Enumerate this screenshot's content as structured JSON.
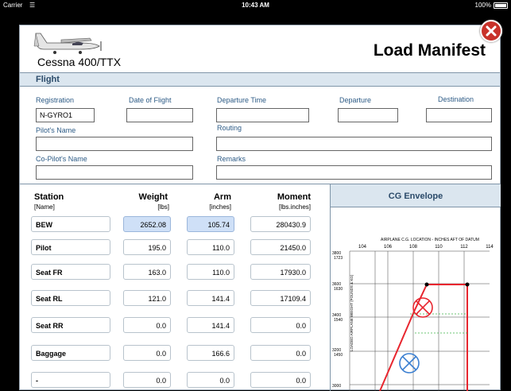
{
  "status_bar": {
    "carrier": "Carrier",
    "time": "10:43 AM",
    "battery": "100%"
  },
  "header": {
    "model": "Cessna 400/TTX",
    "title": "Load Manifest"
  },
  "flight": {
    "section_label": "Flight",
    "registration_label": "Registration",
    "registration_value": "N-GYRO1",
    "date_label": "Date of Flight",
    "date_value": "",
    "departure_time_label": "Departure Time",
    "departure_time_value": "",
    "departure_label": "Departure",
    "departure_value": "",
    "destination_label": "Destination",
    "destination_value": "",
    "pilot_label": "Pilot's Name",
    "pilot_value": "",
    "routing_label": "Routing",
    "routing_value": "",
    "copilot_label": "Co-Pilot's Name",
    "copilot_value": "",
    "remarks_label": "Remarks",
    "remarks_value": ""
  },
  "table": {
    "headers": {
      "station": "Station",
      "weight": "Weight",
      "arm": "Arm",
      "moment": "Moment"
    },
    "units": {
      "station": "[Name]",
      "weight": "[lbs]",
      "arm": "[inches]",
      "moment": "[lbs.inches]"
    },
    "rows": [
      {
        "station": "BEW",
        "weight": "2652.08",
        "arm": "105.74",
        "moment": "280430.9"
      },
      {
        "station": "Pilot",
        "weight": "195.0",
        "arm": "110.0",
        "moment": "21450.0"
      },
      {
        "station": "Seat FR",
        "weight": "163.0",
        "arm": "110.0",
        "moment": "17930.0"
      },
      {
        "station": "Seat RL",
        "weight": "121.0",
        "arm": "141.4",
        "moment": "17109.4"
      },
      {
        "station": "Seat RR",
        "weight": "0.0",
        "arm": "141.4",
        "moment": "0.0"
      },
      {
        "station": "Baggage",
        "weight": "0.0",
        "arm": "166.6",
        "moment": "0.0"
      },
      {
        "station": "-",
        "weight": "0.0",
        "arm": "0.0",
        "moment": "0.0"
      }
    ]
  },
  "cg": {
    "section_label": "CG Envelope",
    "chart_title": "AIRPLANE C.G. LOCATION - INCHES AFT OF DATUM",
    "x_ticks": [
      "104",
      "106",
      "108",
      "110",
      "112",
      "114"
    ],
    "y_ticks": [
      {
        "lbs": "3800",
        "kg": "1723"
      },
      {
        "lbs": "3600",
        "kg": "1630"
      },
      {
        "lbs": "3400",
        "kg": "1540"
      },
      {
        "lbs": "3200",
        "kg": "1450"
      },
      {
        "lbs": "3000",
        "kg": ""
      }
    ],
    "y_axis_label": "LOADED AIRPLANE WEIGHT (POUNDS & KG)",
    "colors": {
      "envelope": "#e8262f",
      "takeoff_marker": "#e8262f",
      "landing_marker": "#3b7fd1",
      "guide": "#3cb34a"
    }
  }
}
